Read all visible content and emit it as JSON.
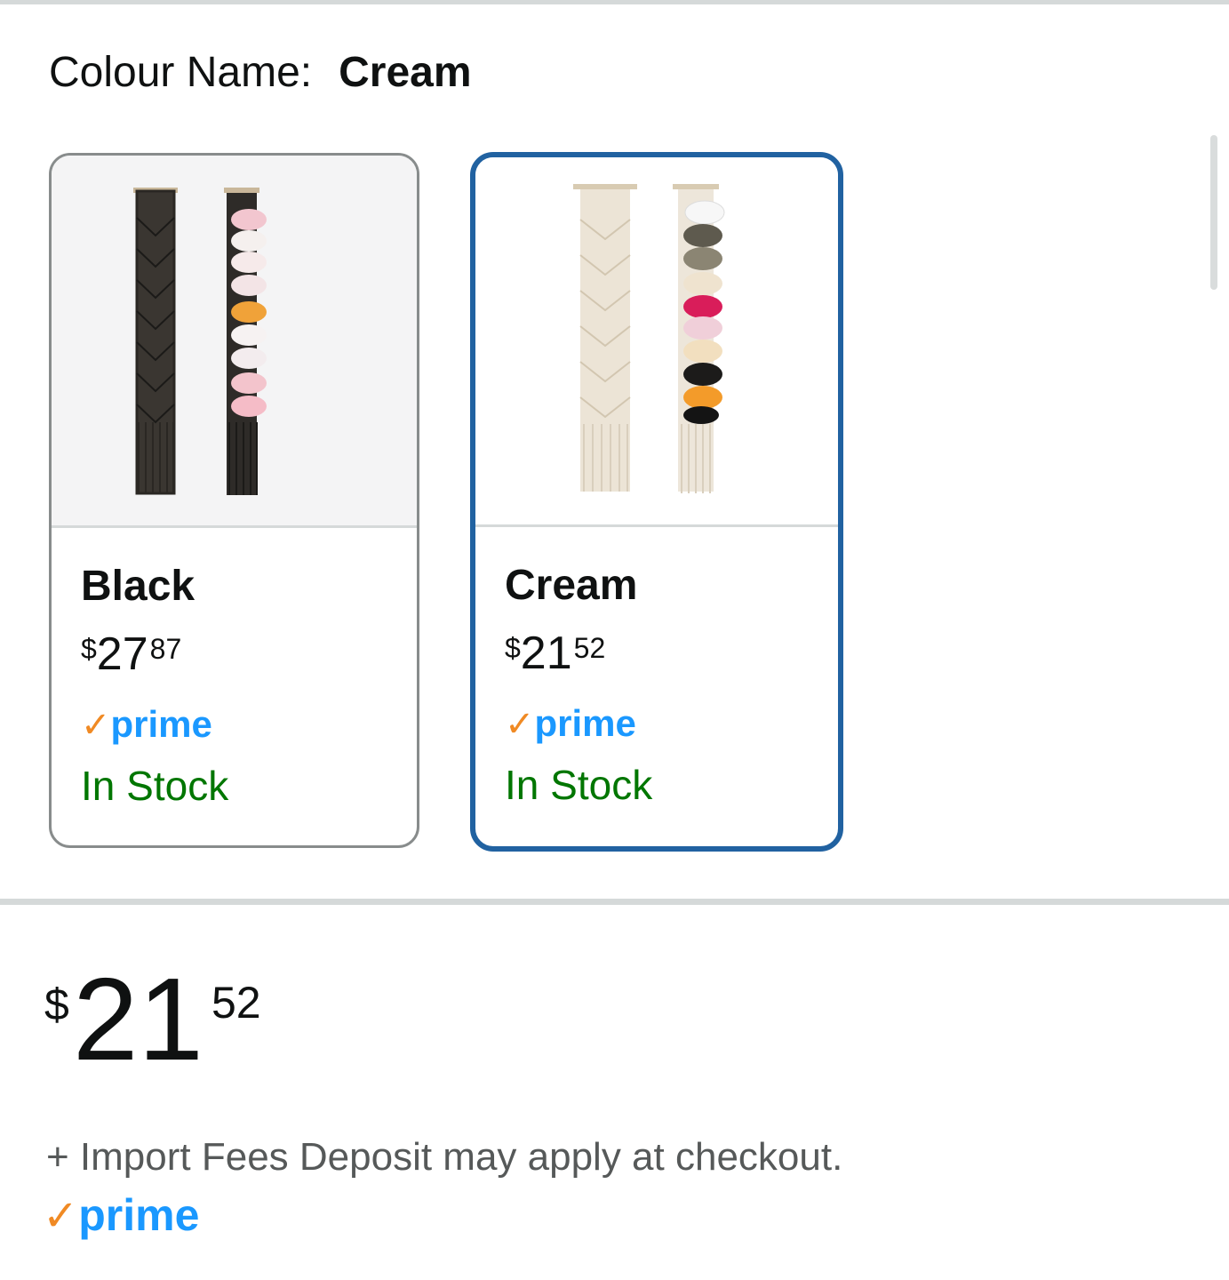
{
  "colour_selector": {
    "label": "Colour Name:",
    "selected_value": "Cream"
  },
  "swatches": [
    {
      "name": "Black",
      "price_symbol": "$",
      "price_whole": "27",
      "price_fraction": "87",
      "prime_check": "✓",
      "prime_label": "prime",
      "stock": "In Stock",
      "selected": false,
      "image_icon": "black-macrame-hat-holder-image"
    },
    {
      "name": "Cream",
      "price_symbol": "$",
      "price_whole": "21",
      "price_fraction": "52",
      "prime_check": "✓",
      "prime_label": "prime",
      "stock": "In Stock",
      "selected": true,
      "image_icon": "cream-macrame-hat-holder-image"
    }
  ],
  "price": {
    "symbol": "$",
    "whole": "21",
    "fraction": "52"
  },
  "import_note": "+ Import Fees Deposit may apply at checkout.",
  "prime": {
    "check": "✓",
    "label": "prime"
  },
  "colors": {
    "selected_border": "#2162a1",
    "unselected_border": "#888c8c",
    "in_stock": "#007600",
    "prime_blue": "#1a98ff",
    "prime_check_orange": "#f08a24",
    "divider": "#d5d9d9"
  }
}
